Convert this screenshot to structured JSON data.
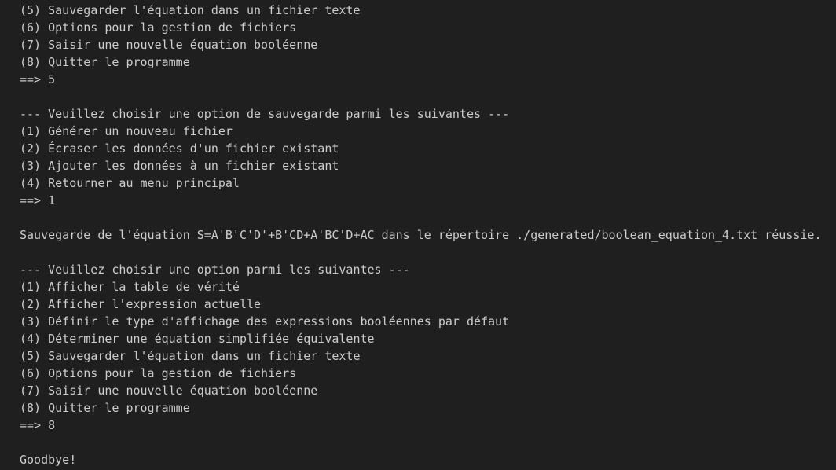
{
  "terminal": {
    "lines": [
      "(5) Sauvegarder l'équation dans un fichier texte",
      "(6) Options pour la gestion de fichiers",
      "(7) Saisir une nouvelle équation booléenne",
      "(8) Quitter le programme",
      "==> 5",
      "",
      "--- Veuillez choisir une option de sauvegarde parmi les suivantes ---",
      "(1) Générer un nouveau fichier",
      "(2) Écraser les données d'un fichier existant",
      "(3) Ajouter les données à un fichier existant",
      "(4) Retourner au menu principal",
      "==> 1",
      "",
      "Sauvegarde de l'équation S=A'B'C'D'+B'CD+A'BC'D+AC dans le répertoire ./generated/boolean_equation_4.txt réussie.",
      "",
      "--- Veuillez choisir une option parmi les suivantes ---",
      "(1) Afficher la table de vérité",
      "(2) Afficher l'expression actuelle",
      "(3) Définir le type d'affichage des expressions booléennes par défaut",
      "(4) Déterminer une équation simplifiée équivalente",
      "(5) Sauvegarder l'équation dans un fichier texte",
      "(6) Options pour la gestion de fichiers",
      "(7) Saisir une nouvelle équation booléenne",
      "(8) Quitter le programme",
      "==> 8",
      "",
      "Goodbye!"
    ]
  }
}
